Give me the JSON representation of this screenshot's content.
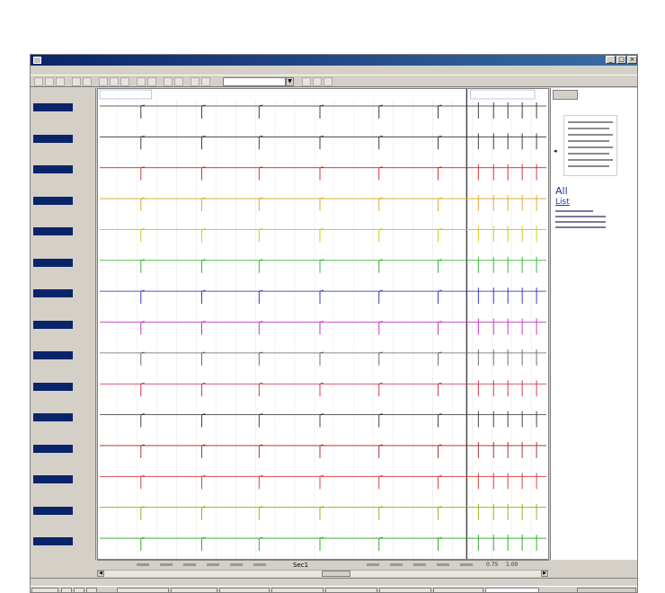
{
  "window": {
    "title": ""
  },
  "menu": [
    {
      "label": ""
    },
    {
      "label": ""
    },
    {
      "label": ""
    },
    {
      "label": ""
    },
    {
      "label": ""
    },
    {
      "label": ""
    },
    {
      "label": ""
    }
  ],
  "toolbar": {
    "combo_value": ""
  },
  "channels": [
    {
      "name": "",
      "color": "#2b2b2b"
    },
    {
      "name": "",
      "color": "#2b2b2b"
    },
    {
      "name": "",
      "color": "#d02020"
    },
    {
      "name": "",
      "color": "#e0a020"
    },
    {
      "name": "",
      "color": "#c8c800"
    },
    {
      "name": "",
      "color": "#20b020"
    },
    {
      "name": "",
      "color": "#2020c8"
    },
    {
      "name": "",
      "color": "#c020c0"
    },
    {
      "name": "",
      "color": "#606060"
    },
    {
      "name": "",
      "color": "#d02040"
    },
    {
      "name": "",
      "color": "#303030"
    },
    {
      "name": "",
      "color": "#a02020"
    },
    {
      "name": "",
      "color": "#d03030"
    },
    {
      "name": "",
      "color": "#a0a000"
    },
    {
      "name": "",
      "color": "#20a020"
    }
  ],
  "time_axis": {
    "section_label": "Sec1",
    "right_values": [
      "0.75",
      "1.00"
    ]
  },
  "right_panel": {
    "all_label": "All",
    "list_label": "List"
  },
  "statusbar": {
    "text": ""
  },
  "taskbar": {
    "start_label": "",
    "active_task": ""
  }
}
